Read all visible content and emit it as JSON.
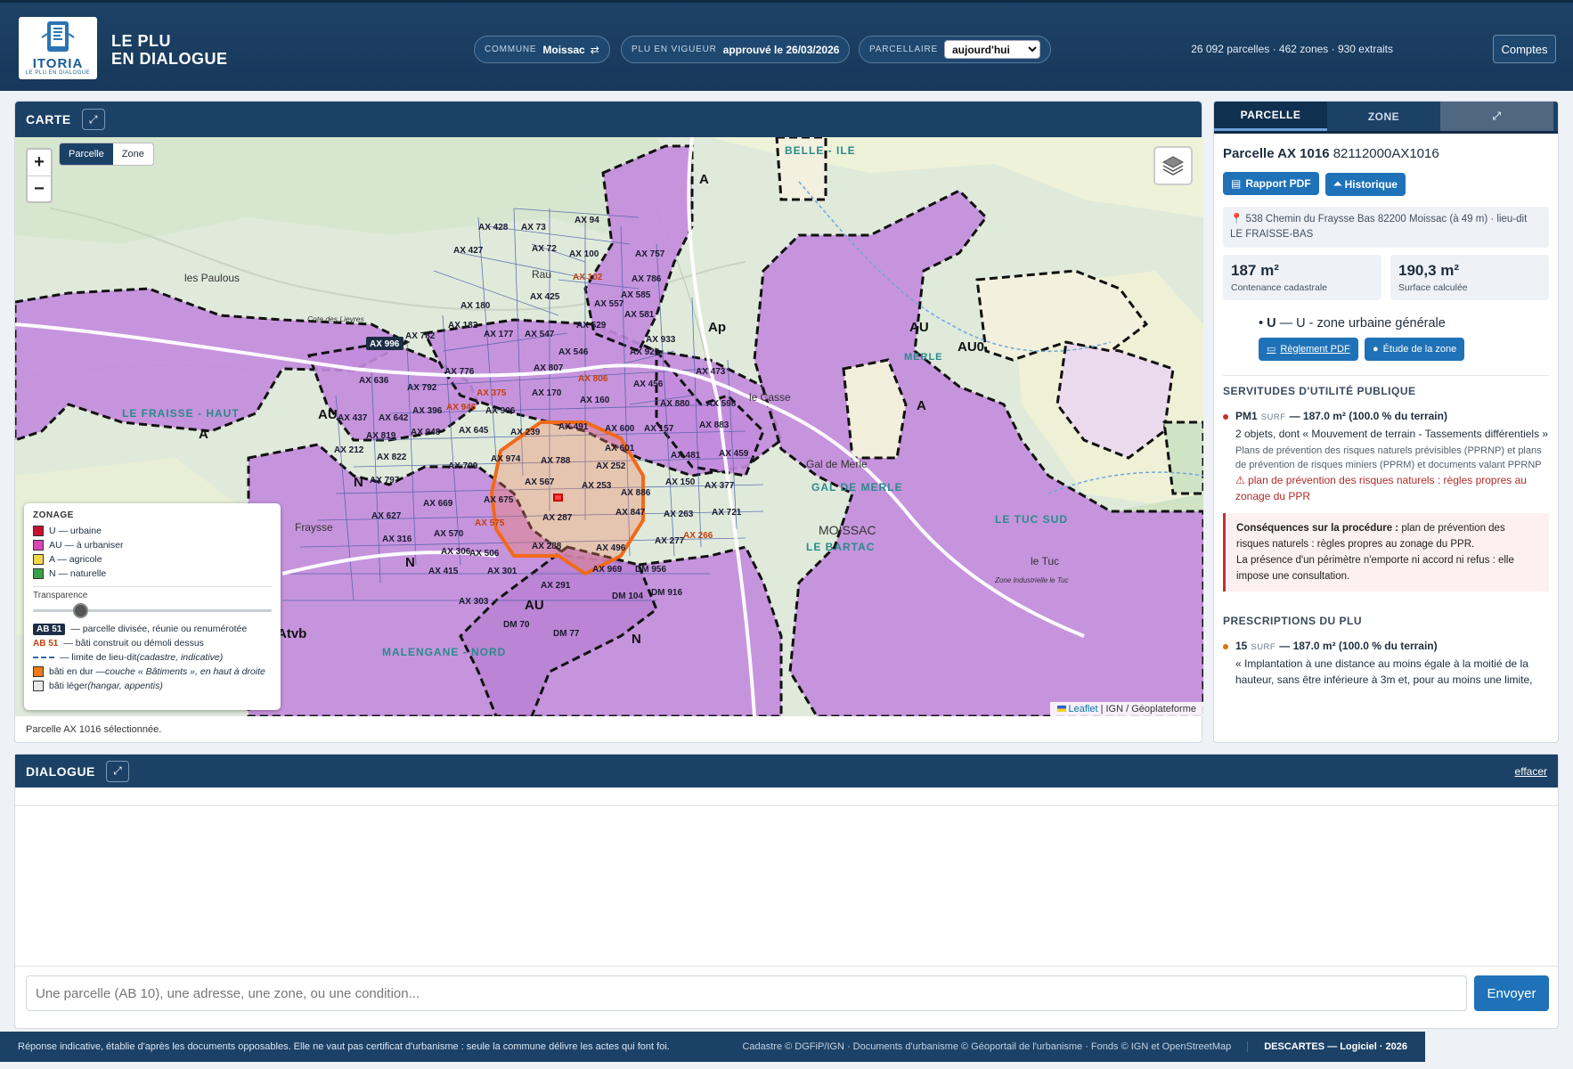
{
  "header": {
    "logo_word": "ITORIA",
    "logo_sub": "LE PLU EN DIALOGUE",
    "title_line1": "LE PLU",
    "title_line2": "EN DIALOGUE",
    "commune_label": "COMMUNE",
    "commune_value": "Moissac",
    "commune_icon": "⇄",
    "plu_label": "PLU EN VIGUEUR",
    "plu_value": "approuvé le 26/03/2026",
    "parcellaire_label": "PARCELLAIRE",
    "parcellaire_value": "aujourd'hui",
    "stats": "26 092 parcelles · 462 zones · 930 extraits",
    "comptes": "Comptes"
  },
  "map": {
    "title": "CARTE",
    "expand_icon": "⤢",
    "zoom_in": "+",
    "zoom_out": "−",
    "mode_parcelle": "Parcelle",
    "mode_zone": "Zone",
    "attribution_leaflet": "Leaflet",
    "attribution_rest": " | IGN / Géoplateforme",
    "status": "Parcelle AX 1016 sélectionnée.",
    "labels": {
      "les_paulous": "les Paulous",
      "cote_lievres": "Cote des Lievres",
      "fraisse_haut": "LE FRAISSE - HAUT",
      "fraysse": "Fraysse",
      "belle_ile": "BELLE - ILE",
      "gal_de_merle": "Gal de Merle",
      "gal_de_merle_caps": "GAL DE MERLE",
      "merle": "MERLE",
      "moissac": "MOISSAC",
      "le_bartac": "LE BARTAC",
      "le_tuc_sud": "LE TUC SUD",
      "le_tuc": "le Tuc",
      "le_casse": "le Casse",
      "zone_industrielle": "Zone Industrielle le Tuc",
      "rau": "Rau",
      "malengane_nord": "MALENGANE - NORD"
    },
    "zones": {
      "a1": "A",
      "a2": "A",
      "a3": "A",
      "au1": "AU",
      "au2": "AU",
      "au3": "AU",
      "au0": "AU0",
      "ap": "Ap",
      "n1": "N",
      "n2": "N",
      "n3": "N",
      "atvb": "Atvb"
    },
    "parcels_dark": [
      "AX 428",
      "AX 73",
      "AX 94",
      "AX 427",
      "AX 72",
      "AX 100",
      "AX 757",
      "AX 786",
      "AX 180",
      "AX 425",
      "AX 557",
      "AX 585",
      "AX 182",
      "AX 529",
      "AX 581",
      "AX 177",
      "AX 547",
      "AX 933",
      "AX 782",
      "AX 546",
      "AX 929",
      "AX 776",
      "AX 807",
      "AX 473",
      "AX 636",
      "AX 792",
      "AX 170",
      "AX 456",
      "AX 880",
      "AX 598",
      "AX 160",
      "AX 906",
      "AX 883",
      "AX 437",
      "AX 642",
      "AX 396",
      "AX 491",
      "AX 600",
      "AX 157",
      "AX 948",
      "AX 645",
      "AX 239",
      "AX 601",
      "AX 212",
      "AX 819",
      "AX 481",
      "AX 459",
      "AX 822",
      "AX 974",
      "AX 788",
      "AX 709",
      "AX 252",
      "AX 797",
      "AX 567",
      "AX 150",
      "AX 377",
      "AX 253",
      "AX 886",
      "AX 675",
      "AX 669",
      "AX 847",
      "AX 263",
      "AX 721",
      "AX 627",
      "AX 287",
      "AX 570",
      "AX 316",
      "AX 277",
      "AX 288",
      "AX 496",
      "AX 306",
      "AX 506",
      "AX 415",
      "AX 301",
      "AX 969",
      "DM 956",
      "AX 291",
      "DM 916",
      "AX 303",
      "DM 104",
      "DM 70",
      "DM 77"
    ],
    "parcels_orange": [
      "AX 102",
      "AX 375",
      "AX 806",
      "AX 946",
      "AX 575",
      "AX 266"
    ],
    "selected_tag": "AX 996"
  },
  "legend": {
    "title": "ZONAGE",
    "u": "U — urbaine",
    "au": "AU — à urbaniser",
    "a": "A — agricole",
    "n": "N — naturelle",
    "transparence": "Transparence",
    "transparence_value": 0.2,
    "tag_dark": "AB 51",
    "tag_dark_text": "— parcelle divisée, réunie ou renumérotée",
    "tag_orange": "AB 51",
    "tag_orange_text": "— bâti construit ou démoli dessus",
    "limite_text": "— limite de lieu-dit ",
    "limite_it": "(cadastre, indicative)",
    "bati_dur": "bâti en dur — ",
    "bati_dur_it": "couche « Bâtiments », en haut à droite",
    "bati_leger": "bâti léger ",
    "bati_leger_it": "(hangar, appentis)",
    "colors": {
      "u": "#c8102e",
      "au": "#d946b8",
      "a": "#f2d64b",
      "n": "#3aa14b",
      "dur": "#f07a1a",
      "leger": "#e8e8e8"
    }
  },
  "side": {
    "tab_parcelle": "PARCELLE",
    "tab_zone": "ZONE",
    "tab_expand": "⤢",
    "parcel_title": "Parcelle AX 1016",
    "parcel_id": "82112000AX1016",
    "btn_rapport": "Rapport PDF",
    "btn_historique": "Historique",
    "address": "538 Chemin du Fraysse Bas 82200 Moissac (à 49 m) · lieu-dit LE FRAISSE-BAS",
    "contenance_value": "187 m²",
    "contenance_label": "Contenance cadastrale",
    "surface_value": "190,3 m²",
    "surface_label": "Surface calculée",
    "zone_code": "U",
    "zone_text": "— U - zone urbaine générale",
    "btn_reglement": "Règlement PDF",
    "btn_etude": "Étude de la zone",
    "sup_title": "SERVITUDES D'UTILITÉ PUBLIQUE",
    "sup_code": "PM1",
    "sup_tag": "SURF",
    "sup_area": "— 187.0 m² (100.0 % du terrain)",
    "sup_desc": "2 objets, dont « Mouvement de terrain - Tassements différentiels »",
    "sup_small": "Plans de prévention des risques naturels prévisibles (PPRNP) et plans de prévention de risques miniers (PPRM) et documents valant PPRNP",
    "sup_warn": "⚠ plan de prévention des risques naturels : règles propres au zonage du PPR",
    "conseq_bold": "Conséquences sur la procédure :",
    "conseq_text": " plan de prévention des risques naturels : règles propres au zonage du PPR.",
    "conseq_text2": "La présence d'un périmètre n'emporte ni accord ni refus : elle impose une consultation.",
    "presc_title": "PRESCRIPTIONS DU PLU",
    "presc_code": "15",
    "presc_tag": "SURF",
    "presc_area": "— 187.0 m² (100.0 % du terrain)",
    "presc_desc": "« Implantation à une distance au moins égale à la moitié de la hauteur, sans être inférieure à 3m et, pour au moins une limite,"
  },
  "dialog": {
    "title": "DIALOGUE",
    "expand_icon": "⤢",
    "clear": "effacer",
    "placeholder": "Une parcelle (AB 10), une adresse, une zone, ou une condition...",
    "send": "Envoyer"
  },
  "footer": {
    "left": "Réponse indicative, établie d'après les documents opposables. Elle ne vaut pas certificat d'urbanisme : seule la commune délivre les actes qui font foi.",
    "mid": "Cadastre © DGFiP/IGN · Documents d'urbanisme © Géoportail de l'urbanisme · Fonds © IGN et OpenStreetMap",
    "right": "DESCARTES — Logiciel · 2026"
  }
}
